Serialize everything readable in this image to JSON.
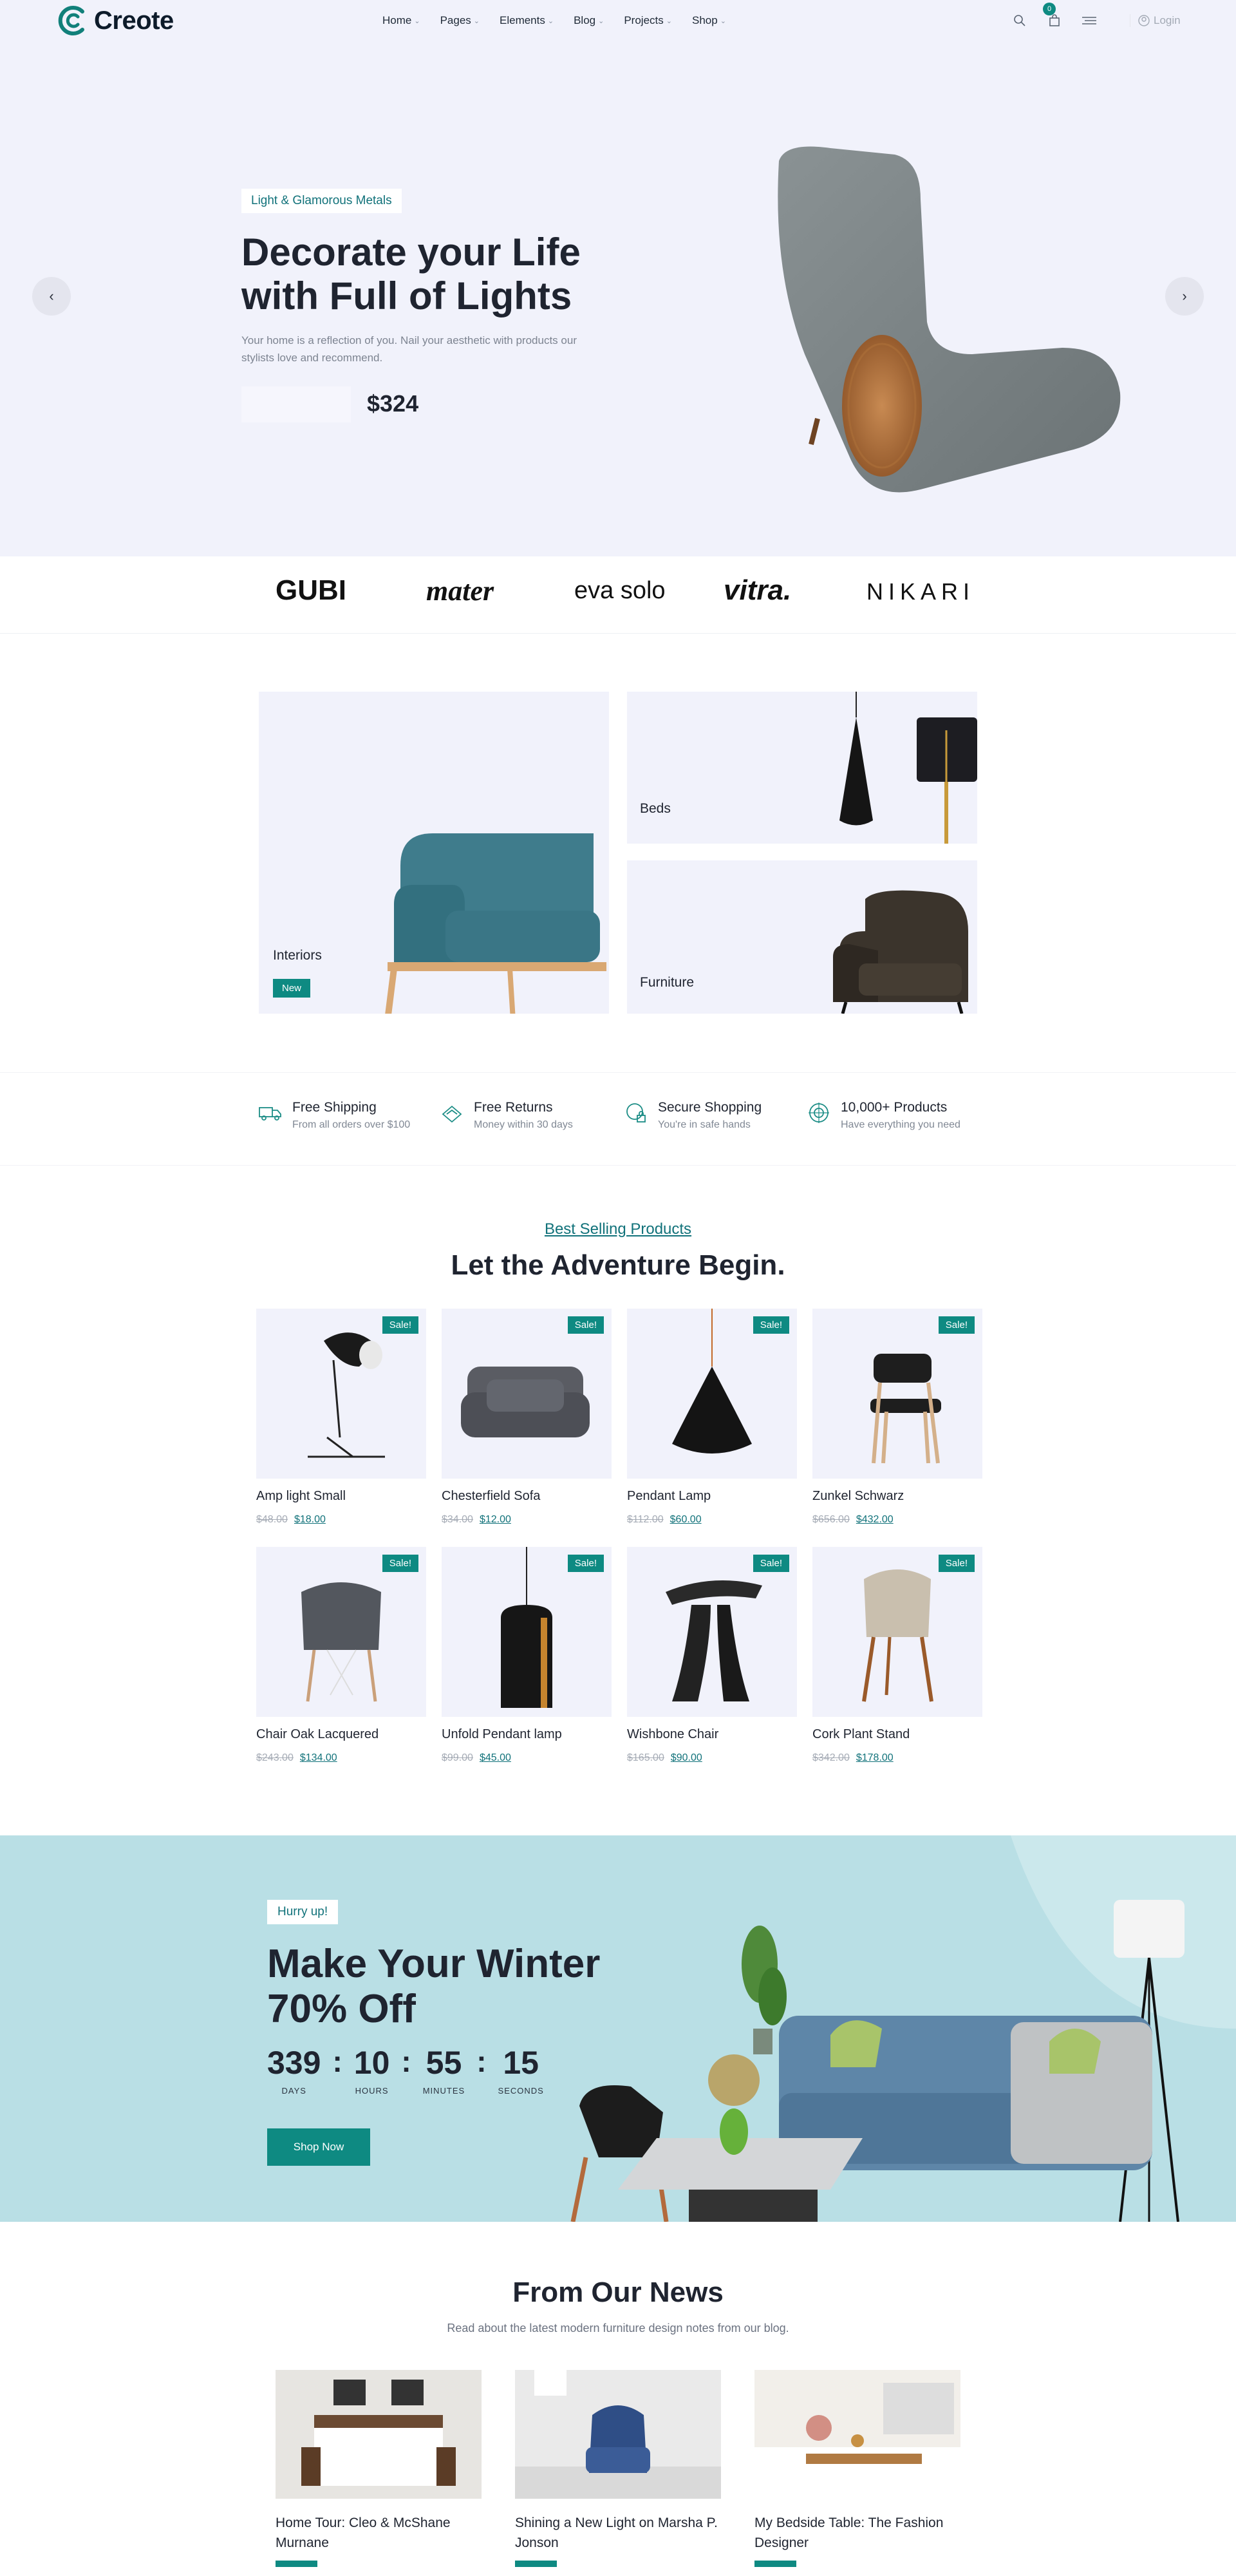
{
  "header": {
    "brand": "Creote",
    "nav": [
      {
        "label": "Home"
      },
      {
        "label": "Pages"
      },
      {
        "label": "Elements"
      },
      {
        "label": "Blog"
      },
      {
        "label": "Projects"
      },
      {
        "label": "Shop"
      }
    ],
    "cart_count": "0",
    "login": "Login"
  },
  "hero": {
    "tag": "Light & Glamorous Metals",
    "title_line1": "Decorate your Life",
    "title_line2": "with Full of Lights",
    "desc": "Your home is a reflection of you. Nail your aesthetic with products our stylists love and recommend.",
    "price": "$324",
    "prev": "‹",
    "next": "›"
  },
  "brands": [
    "GUBI",
    "mater",
    "eva solo",
    "vitra.",
    "NIKARI"
  ],
  "categories": {
    "interiors": {
      "label": "Interiors",
      "badge": "New"
    },
    "beds": {
      "label": "Beds"
    },
    "furniture": {
      "label": "Furniture"
    }
  },
  "features": [
    {
      "title": "Free Shipping",
      "sub": "From all orders over $100",
      "icon": "truck-icon"
    },
    {
      "title": "Free Returns",
      "sub": "Money within 30 days",
      "icon": "returns-icon"
    },
    {
      "title": "Secure Shopping",
      "sub": "You're in safe hands",
      "icon": "secure-icon"
    },
    {
      "title": "10,000+ Products",
      "sub": "Have everything you need",
      "icon": "products-icon"
    }
  ],
  "products_section": {
    "link": "Best Selling Products",
    "title": "Let the Adventure Begin."
  },
  "products": [
    {
      "name": "Amp light Small",
      "old": "$48.00",
      "new": "$18.00",
      "sale": "Sale!",
      "kind": "floorlamp"
    },
    {
      "name": "Chesterfield Sofa",
      "old": "$34.00",
      "new": "$12.00",
      "sale": "Sale!",
      "kind": "sofa"
    },
    {
      "name": "Pendant Lamp",
      "old": "$112.00",
      "new": "$60.00",
      "sale": "Sale!",
      "kind": "pendant"
    },
    {
      "name": "Zunkel Schwarz",
      "old": "$656.00",
      "new": "$432.00",
      "sale": "Sale!",
      "kind": "chair"
    },
    {
      "name": "Chair Oak Lacquered",
      "old": "$243.00",
      "new": "$134.00",
      "sale": "Sale!",
      "kind": "eames"
    },
    {
      "name": "Unfold Pendant lamp",
      "old": "$99.00",
      "new": "$45.00",
      "sale": "Sale!",
      "kind": "cylinder"
    },
    {
      "name": "Wishbone Chair",
      "old": "$165.00",
      "new": "$90.00",
      "sale": "Sale!",
      "kind": "stool"
    },
    {
      "name": "Cork Plant Stand",
      "old": "$342.00",
      "new": "$178.00",
      "sale": "Sale!",
      "kind": "beige"
    }
  ],
  "winter": {
    "tag": "Hurry up!",
    "title_line1": "Make Your Winter",
    "title_line2": "70% Off",
    "countdown": [
      {
        "value": "339",
        "label": "DAYS"
      },
      {
        "value": "10",
        "label": "HOURS"
      },
      {
        "value": "55",
        "label": "MINUTES"
      },
      {
        "value": "15",
        "label": "SECONDS"
      }
    ],
    "button": "Shop Now"
  },
  "news": {
    "title": "From Our News",
    "sub": "Read about the latest modern furniture design notes from our blog.",
    "posts": [
      {
        "title": "Home Tour: Cleo & McShane Murnane",
        "kind": "bedroom"
      },
      {
        "title": "Shining a New Light on Marsha P. Jonson",
        "kind": "armchair"
      },
      {
        "title": "My Bedside Table: The Fashion Designer",
        "kind": "kitchen"
      }
    ]
  },
  "colors": {
    "accent": "#0e8a82",
    "hero_bg": "#f1f2fb",
    "winter_bg": "#b9dfe5",
    "text": "#1f2430"
  }
}
